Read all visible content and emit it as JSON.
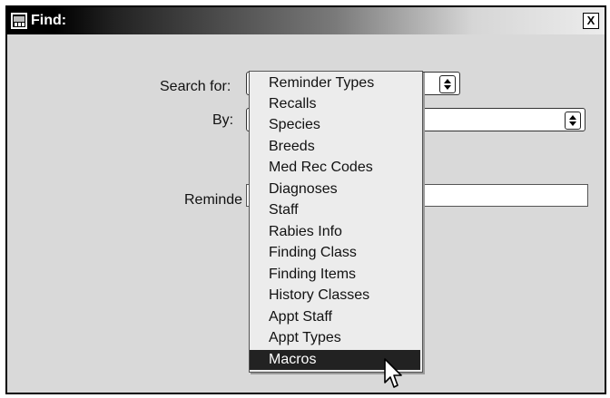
{
  "window": {
    "title": "Find:",
    "close_label": "X"
  },
  "form": {
    "search_for_label": "Search for:",
    "by_label": "By:",
    "reminder_label": "Reminde",
    "by_value": "",
    "reminder_value": ""
  },
  "dropdown": {
    "items": [
      "Reminder Types",
      "Recalls",
      "Species",
      "Breeds",
      "Med Rec Codes",
      "Diagnoses",
      "Staff",
      "Rabies Info",
      "Finding Class",
      "Finding Items",
      "History Classes",
      "Appt Staff",
      "Appt Types",
      "Macros"
    ],
    "highlighted": "Macros"
  },
  "icons": {
    "title": "window-app-icon",
    "close": "close-icon",
    "spinner": "up-down-arrows-icon",
    "cursor": "mouse-pointer-icon"
  },
  "colors": {
    "highlight": "#222222",
    "dialog_bg": "#d9d9d9",
    "titlebar_dark": "#000000"
  }
}
